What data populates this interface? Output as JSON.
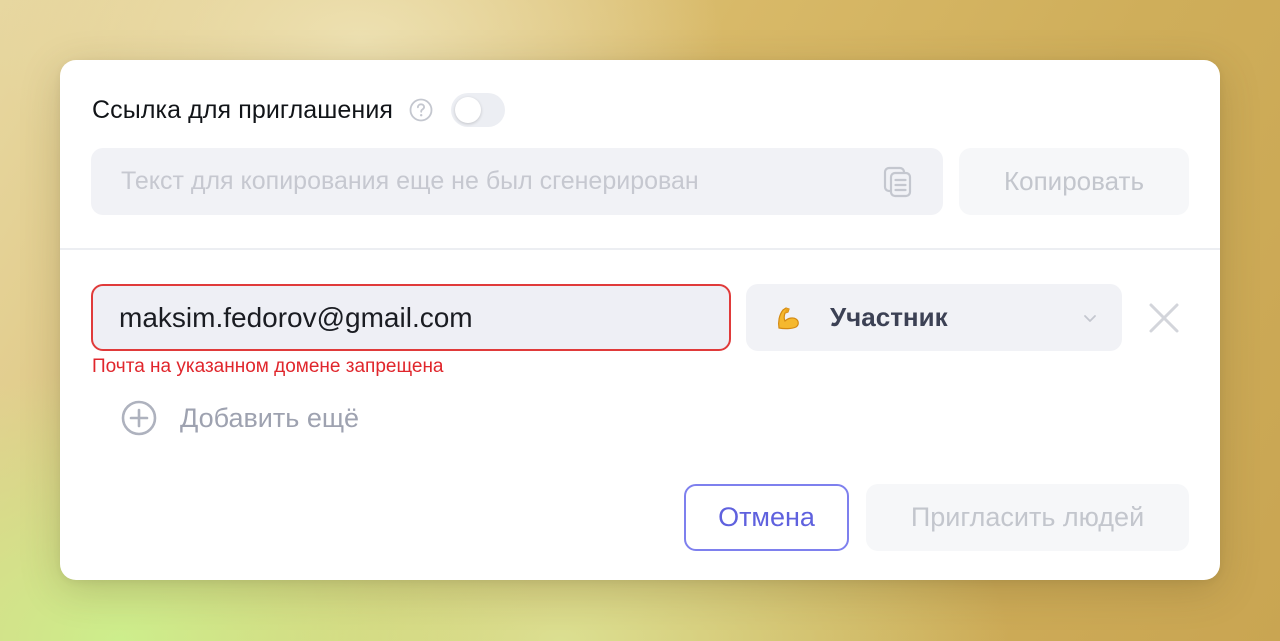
{
  "invite_link": {
    "title": "Ссылка для приглашения",
    "help_icon": "question-circle-icon",
    "toggle_enabled": false,
    "placeholder": "Текст для копирования еще не был сгенерирован",
    "copy_icon": "copy-documents-icon",
    "copy_label": "Копировать"
  },
  "invitee": {
    "email": "maksim.fedorov@gmail.com",
    "error": "Почта на указанном домене запрещена",
    "role": {
      "emoji_icon": "flexed-biceps-icon",
      "label": "Участник"
    },
    "remove_icon": "close-icon"
  },
  "add_more": {
    "icon": "plus-circle-icon",
    "label": "Добавить ещё"
  },
  "actions": {
    "cancel_label": "Отмена",
    "invite_label": "Пригласить людей"
  },
  "colors": {
    "error": "#e0262c",
    "accent": "#5f61de",
    "disabled_text": "#c3c6cd"
  }
}
